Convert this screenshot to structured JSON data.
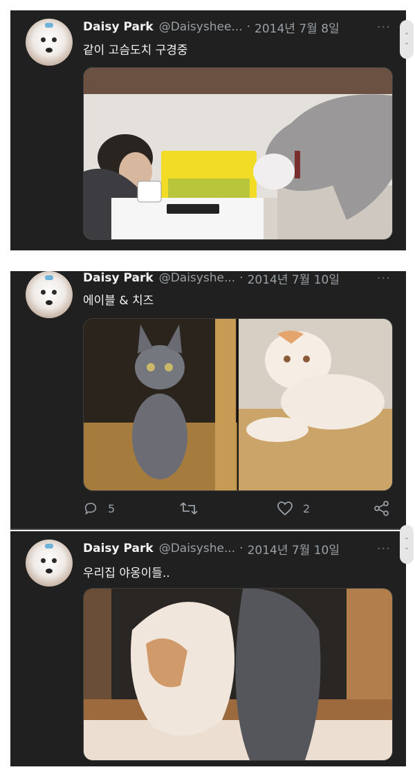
{
  "tweets": [
    {
      "name": "Daisy Park",
      "handle": "@Daisyshee...",
      "separator": "·",
      "date": "2014년 7월 8일",
      "text": "같이 고슴도치 구경중",
      "more": "···"
    },
    {
      "name": "Daisy Park",
      "handle": "@Daisyshe...",
      "separator": "·",
      "date": "2014년 7월 10일",
      "text": "에이블 & 치즈",
      "more": "···",
      "actions": {
        "reply_count": "5",
        "retweet_count": "",
        "like_count": "2"
      }
    },
    {
      "name": "Daisy Park",
      "handle": "@Daisyshe...",
      "separator": "·",
      "date": "2014년 7월 10일",
      "text": "우리집 야옹이들..",
      "more": "···"
    }
  ],
  "colors": {
    "background": "#202020",
    "text": "#f3f3f3",
    "secondary": "#9aa0a6"
  },
  "icons": [
    "reply-icon",
    "retweet-icon",
    "like-icon",
    "share-icon",
    "more-icon",
    "scroll-handle-icon"
  ]
}
